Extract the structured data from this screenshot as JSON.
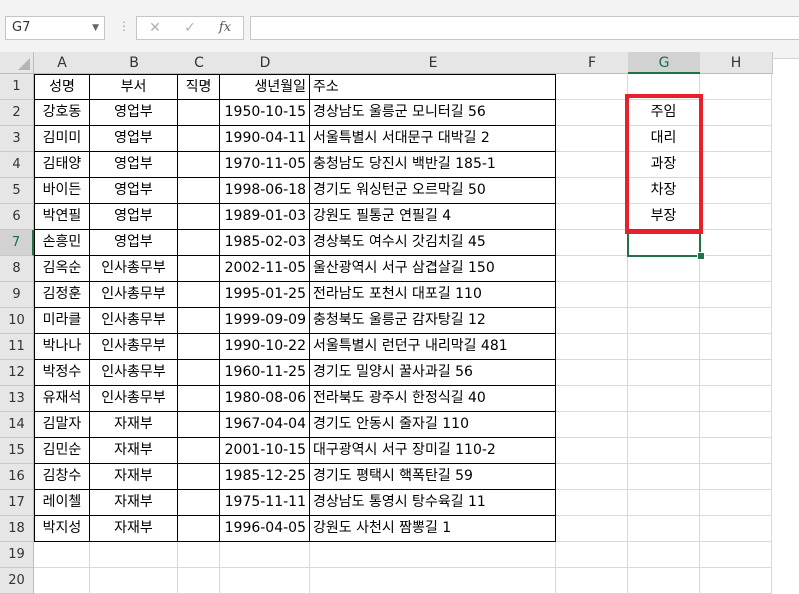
{
  "formula_bar": {
    "name_box": "G7",
    "separator": "⋮",
    "cancel_icon": "✕",
    "enter_icon": "✓",
    "fx_label": "fx",
    "formula": ""
  },
  "columns": [
    "A",
    "B",
    "C",
    "D",
    "E",
    "F",
    "G",
    "H"
  ],
  "rows": [
    [
      "성명",
      "부서",
      "직명",
      "생년월일",
      "주소",
      "",
      "",
      ""
    ],
    [
      "강호동",
      "영업부",
      "",
      "1950-10-15",
      "경상남도 울릉군 모니터길 56",
      "",
      "주임",
      ""
    ],
    [
      "김미미",
      "영업부",
      "",
      "1990-04-11",
      "서울특별시 서대문구 대박길 2",
      "",
      "대리",
      ""
    ],
    [
      "김태양",
      "영업부",
      "",
      "1970-11-05",
      "충청남도 당진시 백반길 185-1",
      "",
      "과장",
      ""
    ],
    [
      "바이든",
      "영업부",
      "",
      "1998-06-18",
      "경기도 워싱턴군 오르막길 50",
      "",
      "차장",
      ""
    ],
    [
      "박연필",
      "영업부",
      "",
      "1989-01-03",
      "강원도 필통군 연필길 4",
      "",
      "부장",
      ""
    ],
    [
      "손흥민",
      "영업부",
      "",
      "1985-02-03",
      "경상북도 여수시 갓김치길 45",
      "",
      "",
      ""
    ],
    [
      "김옥순",
      "인사총무부",
      "",
      "2002-11-05",
      "울산광역시 서구 삼겹살길 150",
      "",
      "",
      ""
    ],
    [
      "김정훈",
      "인사총무부",
      "",
      "1995-01-25",
      "전라남도 포천시 대포길 110",
      "",
      "",
      ""
    ],
    [
      "미라클",
      "인사총무부",
      "",
      "1999-09-09",
      "충청북도 울릉군 감자탕길 12",
      "",
      "",
      ""
    ],
    [
      "박나나",
      "인사총무부",
      "",
      "1990-10-22",
      "서울특별시 런던구 내리막길 481",
      "",
      "",
      ""
    ],
    [
      "박정수",
      "인사총무부",
      "",
      "1960-11-25",
      "경기도 밀양시 꿀사과길 56",
      "",
      "",
      ""
    ],
    [
      "유재석",
      "인사총무부",
      "",
      "1980-08-06",
      "전라북도 광주시 한정식길 40",
      "",
      "",
      ""
    ],
    [
      "김말자",
      "자재부",
      "",
      "1967-04-04",
      "경기도 안동시 줄자길 110",
      "",
      "",
      ""
    ],
    [
      "김민순",
      "자재부",
      "",
      "2001-10-15",
      "대구광역시 서구 장미길 110-2",
      "",
      "",
      ""
    ],
    [
      "김창수",
      "자재부",
      "",
      "1985-12-25",
      "경기도 평택시 핵폭탄길 59",
      "",
      "",
      ""
    ],
    [
      "레이첼",
      "자재부",
      "",
      "1975-11-11",
      "경상남도 통영시 탕수육길 11",
      "",
      "",
      ""
    ],
    [
      "박지성",
      "자재부",
      "",
      "1996-04-05",
      "강원도 사천시 짬뽕길 1",
      "",
      "",
      ""
    ],
    [
      "",
      "",
      "",
      "",
      "",
      "",
      "",
      ""
    ],
    [
      "",
      "",
      "",
      "",
      "",
      "",
      "",
      ""
    ]
  ],
  "row_numbers": [
    "1",
    "2",
    "3",
    "4",
    "5",
    "6",
    "7",
    "8",
    "9",
    "10",
    "11",
    "12",
    "13",
    "14",
    "15",
    "16",
    "17",
    "18",
    "19",
    "20"
  ],
  "selected_cell": "G7",
  "colors": {
    "selection": "#217346",
    "highlight_box": "#e8202c"
  }
}
